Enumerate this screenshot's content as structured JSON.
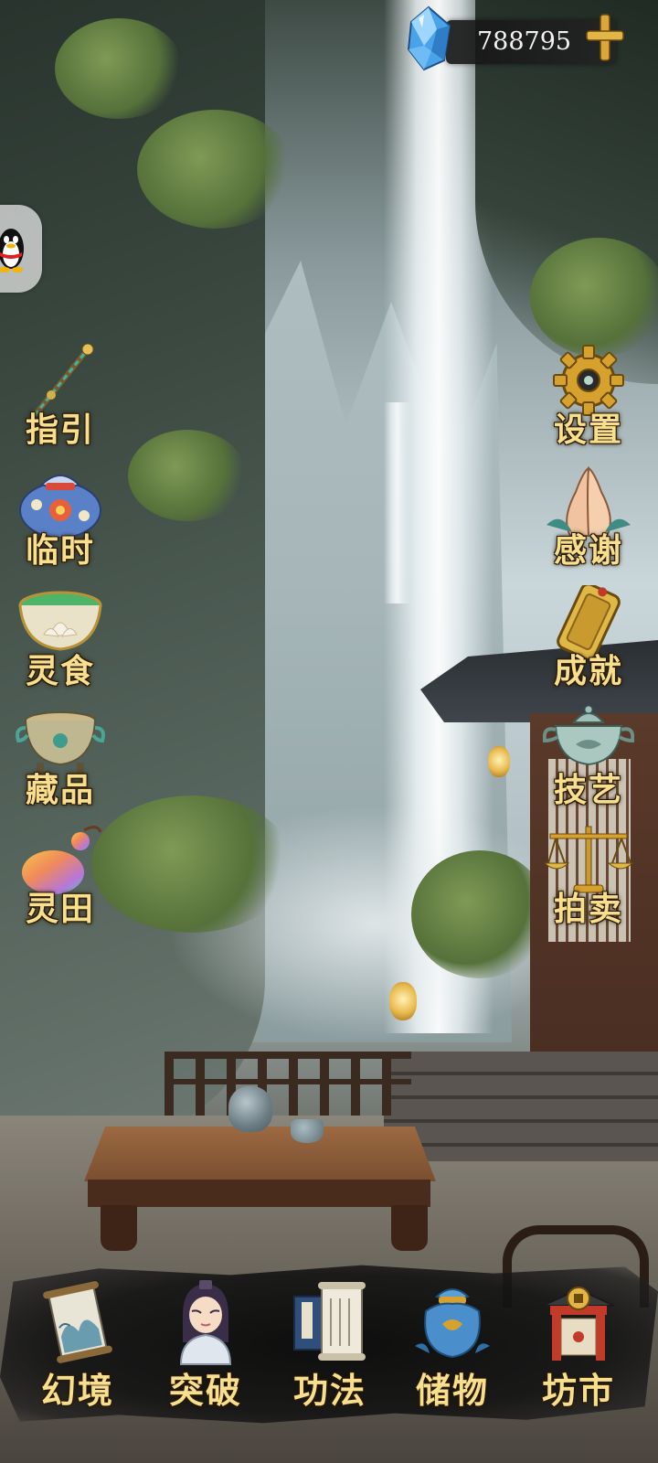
{
  "currency": {
    "icon": "diamond-gem-icon",
    "amount": "788795",
    "add_icon": "plus-icon"
  },
  "floating": {
    "qq_icon": "qq-penguin-icon"
  },
  "left_menu": [
    {
      "label": "指引",
      "icon": "jade-scepter-icon"
    },
    {
      "label": "临时",
      "icon": "pouch-bag-icon"
    },
    {
      "label": "灵食",
      "icon": "lotus-bowl-icon"
    },
    {
      "label": "藏品",
      "icon": "bronze-cauldron-icon"
    },
    {
      "label": "灵田",
      "icon": "gourd-icon"
    }
  ],
  "right_menu": [
    {
      "label": "设置",
      "icon": "gear-icon"
    },
    {
      "label": "感谢",
      "icon": "praying-hands-icon"
    },
    {
      "label": "成就",
      "icon": "golden-token-icon"
    },
    {
      "label": "技艺",
      "icon": "censer-icon"
    },
    {
      "label": "拍卖",
      "icon": "balance-scale-icon"
    }
  ],
  "bottom_nav": [
    {
      "label": "幻境",
      "icon": "scroll-painting-icon"
    },
    {
      "label": "突破",
      "icon": "cultivator-avatar-icon"
    },
    {
      "label": "功法",
      "icon": "book-scroll-icon"
    },
    {
      "label": "储物",
      "icon": "storage-bag-icon"
    },
    {
      "label": "坊市",
      "icon": "market-gate-icon"
    }
  ],
  "theme": {
    "label_color": "#f7df8e",
    "label_outline": "#2a1a05"
  }
}
